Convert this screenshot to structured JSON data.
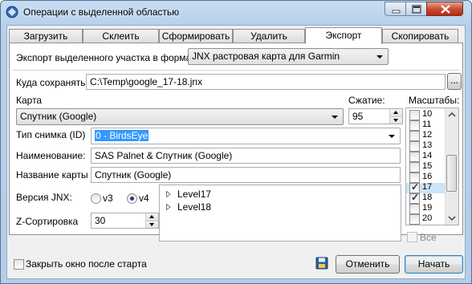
{
  "window": {
    "title": "Операции с выделенной областью",
    "accent": "#b7d0ea"
  },
  "tabs": [
    {
      "label": "Загрузить",
      "active": false
    },
    {
      "label": "Склеить",
      "active": false
    },
    {
      "label": "Сформировать",
      "active": false
    },
    {
      "label": "Удалить",
      "active": false
    },
    {
      "label": "Экспорт",
      "active": true
    },
    {
      "label": "Скопировать",
      "active": false
    }
  ],
  "export_format": {
    "label": "Экспорт выделенного участка в формат",
    "value": "JNX растровая карта для Garmin"
  },
  "save_path": {
    "label": "Куда сохранять:",
    "value": "C:\\Temp\\google_17-18.jnx",
    "browse_label": "..."
  },
  "map": {
    "label": "Карта",
    "value": "Спутник (Google)"
  },
  "compression": {
    "label": "Сжатие:",
    "value": "95"
  },
  "image_type": {
    "label": "Тип снимка (ID)",
    "value": "0 - BirdsEye"
  },
  "name": {
    "label": "Наименование:",
    "value": "SAS Palnet & Спутник (Google)"
  },
  "map_name": {
    "label": "Название карты",
    "value": "Спутник (Google)"
  },
  "jnx_version": {
    "label": "Версия JNX:",
    "options": [
      {
        "label": "v3",
        "checked": false
      },
      {
        "label": "v4",
        "checked": true
      }
    ]
  },
  "z_order": {
    "label": "Z-Сортировка",
    "value": "30"
  },
  "levels": [
    "Level17",
    "Level18"
  ],
  "scales": {
    "label": "Масштабы:",
    "items": [
      {
        "label": "10",
        "checked": false,
        "selected": false
      },
      {
        "label": "11",
        "checked": false,
        "selected": false
      },
      {
        "label": "12",
        "checked": false,
        "selected": false
      },
      {
        "label": "13",
        "checked": false,
        "selected": false
      },
      {
        "label": "14",
        "checked": false,
        "selected": false
      },
      {
        "label": "15",
        "checked": false,
        "selected": false
      },
      {
        "label": "16",
        "checked": false,
        "selected": false
      },
      {
        "label": "17",
        "checked": true,
        "selected": true
      },
      {
        "label": "18",
        "checked": true,
        "selected": false
      },
      {
        "label": "19",
        "checked": false,
        "selected": false
      },
      {
        "label": "20",
        "checked": false,
        "selected": false
      }
    ],
    "all_label": "Все"
  },
  "footer": {
    "close_after_start": "Закрыть окно после старта",
    "cancel_label": "Отменить",
    "start_label": "Начать"
  }
}
